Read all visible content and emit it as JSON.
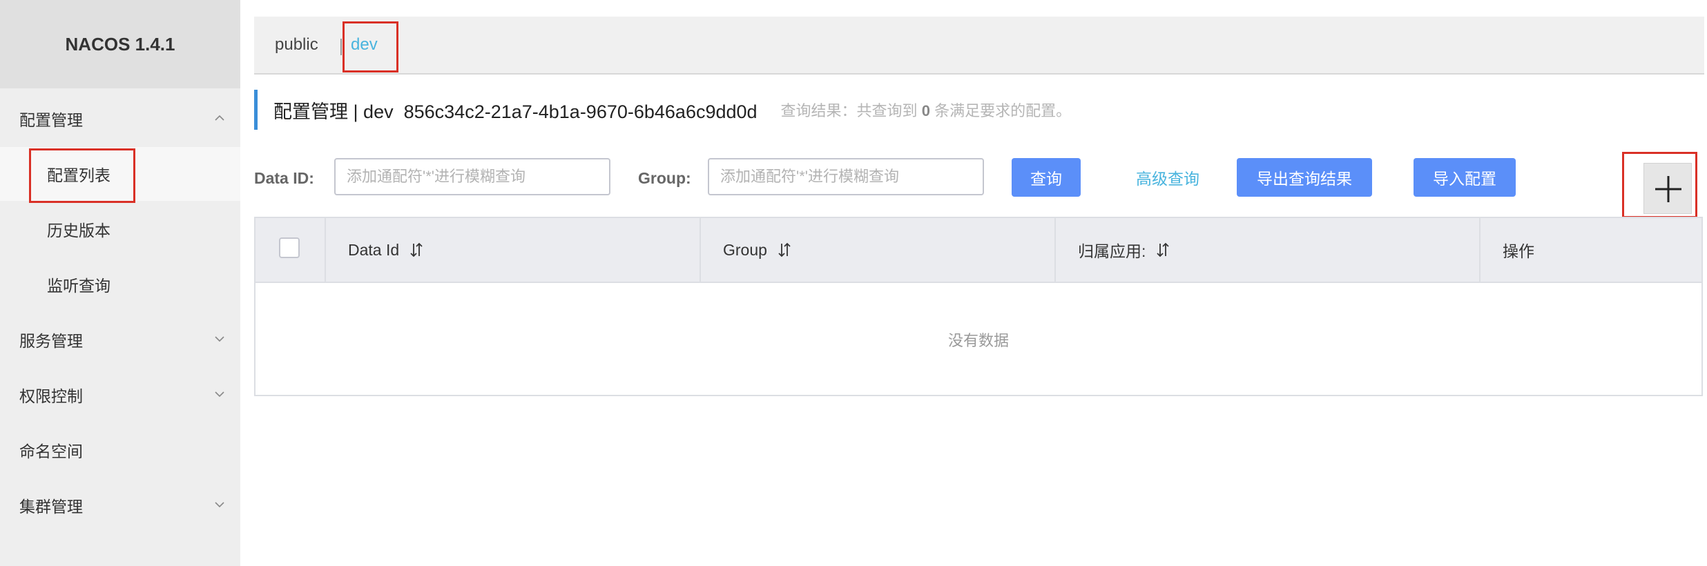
{
  "app": {
    "brand": "NACOS 1.4.1"
  },
  "sidebar": {
    "groups": [
      {
        "label": "配置管理",
        "expanded": true,
        "children": [
          "配置列表",
          "历史版本",
          "监听查询"
        ],
        "active_child": "配置列表"
      },
      {
        "label": "服务管理",
        "expanded": false
      },
      {
        "label": "权限控制",
        "expanded": false
      },
      {
        "label": "命名空间"
      },
      {
        "label": "集群管理",
        "expanded": false
      }
    ]
  },
  "namespace_tabs": {
    "items": [
      "public",
      "dev"
    ],
    "active": "dev",
    "separator": "|"
  },
  "header": {
    "title": "配置管理",
    "separator": "|",
    "namespace": "dev",
    "namespace_id": "856c34c2-21a7-4b1a-9670-6b46a6c9dd0d",
    "result_prefix": "查询结果：共查询到",
    "result_count": "0",
    "result_suffix": "条满足要求的配置。"
  },
  "search": {
    "data_id_label": "Data ID:",
    "data_id_placeholder": "添加通配符'*'进行模糊查询",
    "group_label": "Group:",
    "group_placeholder": "添加通配符'*'进行模糊查询",
    "query_button": "查询",
    "advanced_link": "高级查询",
    "export_button": "导出查询结果",
    "import_button": "导入配置",
    "add_button_icon": "plus-icon"
  },
  "table": {
    "columns": [
      "Data Id",
      "Group",
      "归属应用:",
      "操作"
    ],
    "empty_text": "没有数据"
  },
  "colors": {
    "primary": "#5b8ff9",
    "link": "#49b4de",
    "accent_bar": "#3a8ed8",
    "highlight_box": "#d93026"
  }
}
